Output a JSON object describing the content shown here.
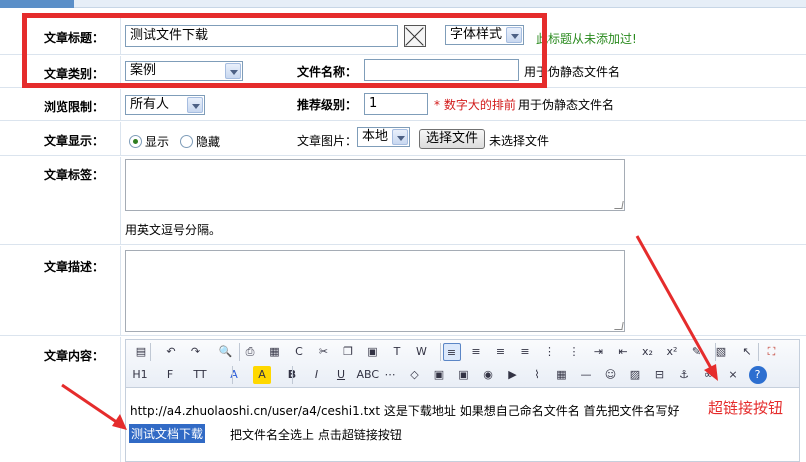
{
  "form": {
    "title": {
      "label": "文章标题：",
      "value": "测试文件下载",
      "style_select": "字体样式",
      "hint": "此标题从未添加过!"
    },
    "category": {
      "label": "文章类别：",
      "value": "案例",
      "filename_label": "文件名称：",
      "filename_value": "",
      "filename_hint": "用于伪静态文件名"
    },
    "browse": {
      "label": "浏览限制：",
      "value": "所有人",
      "recommend_label": "推荐级别：",
      "recommend_value": "1",
      "recommend_note": "* 数字大的排前",
      "recommend_hint": "用于伪静态文件名"
    },
    "display": {
      "label": "文章显示：",
      "show": "显示",
      "hide": "隐藏",
      "image_label": "文章图片：",
      "image_source": "本地",
      "choose_file": "选择文件",
      "no_file": "未选择文件"
    },
    "tags": {
      "label": "文章标签：",
      "hint": "用英文逗号分隔。"
    },
    "desc": {
      "label": "文章描述："
    },
    "content": {
      "label": "文章内容：",
      "line1": "http://a4.zhuolaoshi.cn/user/a4/ceshi1.txt  这是下载地址 如果想自己命名文件名 首先把文件名写好",
      "selected": "测试文档下载",
      "line2": "把文件名全选上  点击超链接按钮"
    }
  },
  "toolbar": {
    "row1": [
      "source-icon",
      "undo-icon",
      "redo-icon",
      "preview-icon",
      "print-icon",
      "template-icon",
      "code-icon",
      "cut-icon",
      "copy-icon",
      "paste-icon",
      "paste-text-icon",
      "paste-word-icon",
      "align-left-icon",
      "align-center-icon",
      "align-right-icon",
      "justify-icon",
      "ordered-list-icon",
      "unordered-list-icon",
      "indent-icon",
      "outdent-icon",
      "subscript-icon",
      "superscript-icon",
      "clear-format-icon",
      "select-all-icon",
      "pointer-icon",
      "fullscreen-icon"
    ],
    "row2": [
      "heading-icon",
      "font-family-icon",
      "font-size-icon",
      "font-color-icon",
      "highlight-color-icon",
      "bold-icon",
      "italic-icon",
      "underline-icon",
      "strikethrough-icon",
      "line-height-icon",
      "remove-format-icon",
      "image-icon",
      "insert-image-icon",
      "flash-icon",
      "media-icon",
      "attachment-icon",
      "table-icon",
      "hr-icon",
      "emoticon-icon",
      "map-icon",
      "page-break-icon",
      "anchor-icon",
      "link-icon",
      "unlink-icon",
      "help-icon"
    ]
  },
  "annotation": {
    "text": "超链接按钮"
  },
  "colors": {
    "highlight_red": "#e52c2c",
    "hint_green": "#2a8a1e",
    "selection_blue": "#316ac5"
  }
}
